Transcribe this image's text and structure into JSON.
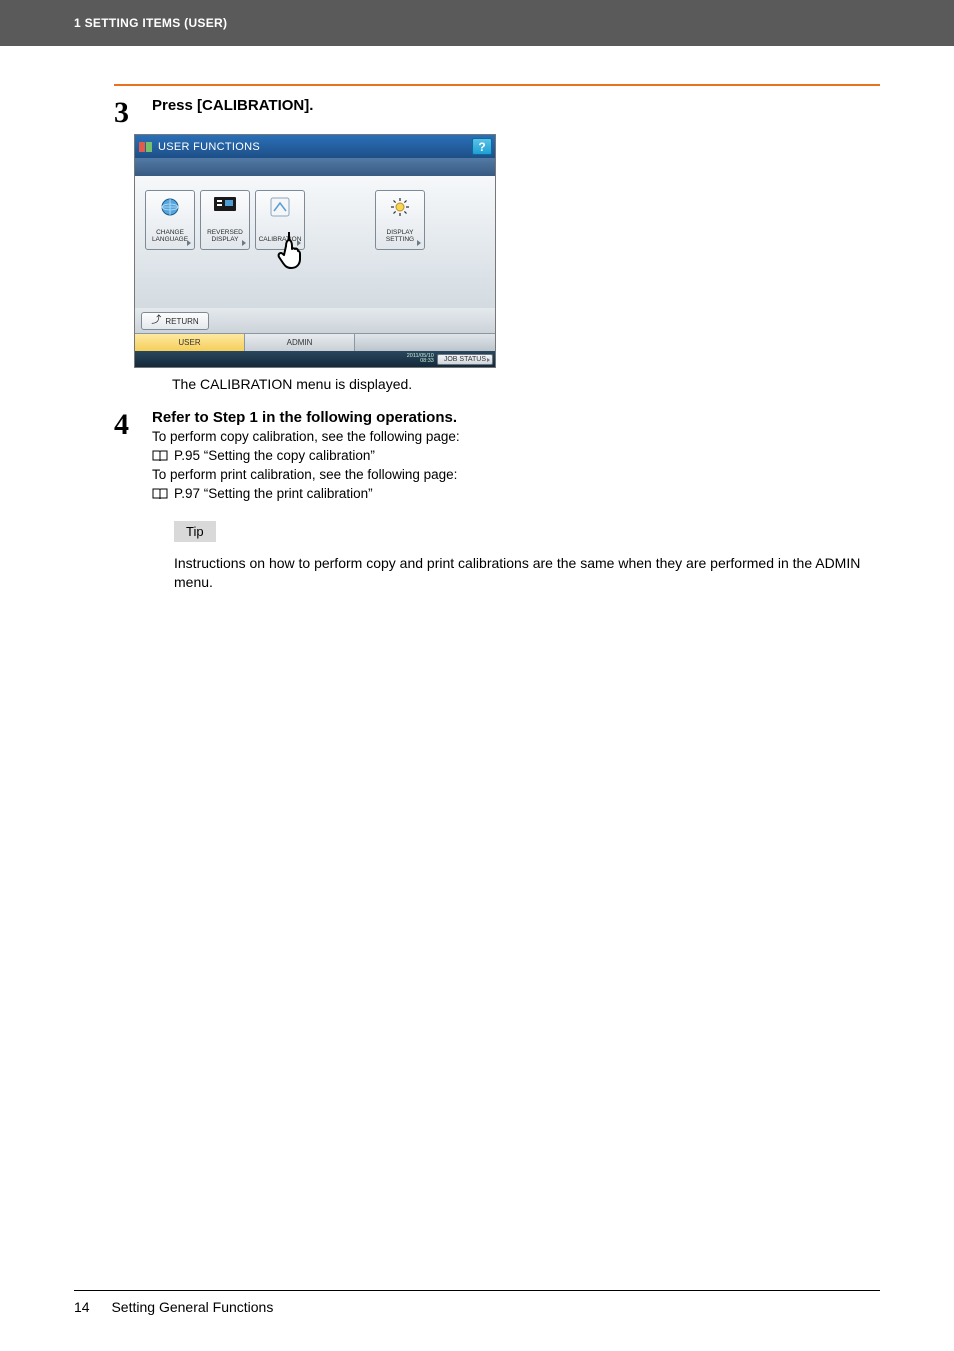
{
  "header": {
    "section": "1 SETTING ITEMS (USER)"
  },
  "step3": {
    "number": "3",
    "title": "Press [CALIBRATION].",
    "after_text": "The CALIBRATION menu is displayed."
  },
  "screenshot": {
    "title": "USER FUNCTIONS",
    "help": "?",
    "buttons": {
      "change_language": "CHANGE\nLANGUAGE",
      "reversed_display": "REVERSED\nDISPLAY",
      "calibration": "CALIBRATION",
      "display_setting": "DISPLAY\nSETTING"
    },
    "return_btn": "RETURN",
    "tabs": {
      "user": "USER",
      "admin": "ADMIN"
    },
    "status": {
      "date": "2011/05/10",
      "time": "08:33",
      "job_status": "JOB STATUS"
    }
  },
  "step4": {
    "number": "4",
    "title": "Refer to Step 1 in the following operations.",
    "line1": "To perform copy calibration, see the following page:",
    "ref1": "P.95 “Setting the copy calibration”",
    "line2": "To perform print calibration, see the following page:",
    "ref2": "P.97 “Setting the print calibration”",
    "tip_label": "Tip",
    "tip_text": "Instructions on how to perform copy and print calibrations are the same when they are performed in the ADMIN menu."
  },
  "footer": {
    "page_number": "14",
    "section_title": "Setting General Functions"
  }
}
